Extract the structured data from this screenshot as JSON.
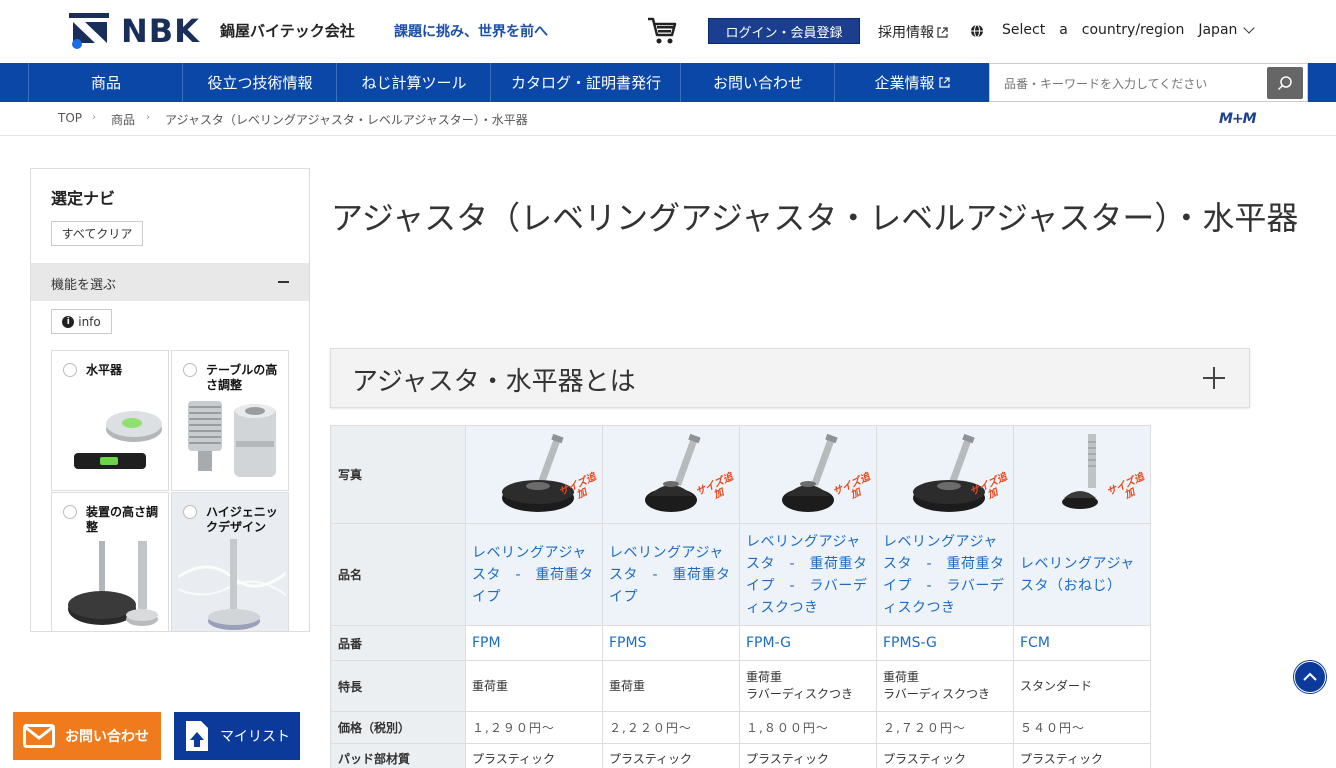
{
  "header": {
    "logo_text": "NBK",
    "company_name": "鍋屋バイテック会社",
    "tagline": "課題に挑み、世界を前へ",
    "login_label": "ログイン・会員登録",
    "recruit_label": "採用情報",
    "region_select": "Select",
    "region_a": "a",
    "region_cr": "country/region",
    "region_value": "Japan"
  },
  "nav": {
    "items": [
      "商品",
      "役立つ技術情報",
      "ねじ計算ツール",
      "カタログ・証明書発行",
      "お問い合わせ",
      "企業情報"
    ],
    "search_placeholder": "品番・キーワードを入力してください"
  },
  "breadcrumb": {
    "items": [
      "TOP",
      "商品",
      "アジャスタ（レベリングアジャスタ・レベルアジャスター）・水平器"
    ],
    "partner_logo": "M+M"
  },
  "sidebar": {
    "title": "選定ナビ",
    "clear_label": "すべてクリア",
    "section_label": "機能を選ぶ",
    "info_label": "info",
    "cards": [
      {
        "label": "水平器"
      },
      {
        "label": "テーブルの高さ調整"
      },
      {
        "label": "装置の高さ調整"
      },
      {
        "label": "ハイジェニックデザイン"
      }
    ]
  },
  "main": {
    "title": "アジャスタ（レベリングアジャスタ・レベルアジャスター）・水平器",
    "accordion_label": "アジャスタ・水平器とは"
  },
  "table": {
    "row_headers": {
      "photo": "写真",
      "name": "品名",
      "code": "品番",
      "feature": "特長",
      "price": "価格（税別）",
      "pad": "パッド部材質"
    },
    "size_tag": "サイズ追加",
    "products": [
      {
        "name": "レベリングアジャスタ　-　重荷重タイプ",
        "code": "FPM",
        "feature": "重荷重",
        "price": "１,２９０円〜",
        "pad": "プラスティック"
      },
      {
        "name": "レベリングアジャスタ　-　重荷重タイプ",
        "code": "FPMS",
        "feature": "重荷重",
        "price": "２,２２０円〜",
        "pad": "プラスティック"
      },
      {
        "name": "レベリングアジャスタ　-　重荷重タイプ　-　ラバーディスクつき",
        "code": "FPM-G",
        "feature": "重荷重\nラバーディスクつき",
        "price": "１,８００円〜",
        "pad": "プラスティック"
      },
      {
        "name": "レベリングアジャスタ　-　重荷重タイプ　-　ラバーディスクつき",
        "code": "FPMS-G",
        "feature": "重荷重\nラバーディスクつき",
        "price": "２,７２０円〜",
        "pad": "プラスティック"
      },
      {
        "name": "レベリングアジャスタ（おねじ）",
        "code": "FCM",
        "feature": "スタンダード",
        "price": "５４０円〜",
        "pad": "プラスティック"
      }
    ]
  },
  "floating": {
    "contact_label": "お問い合わせ",
    "mylist_label": "マイリスト"
  },
  "colors": {
    "brand_blue": "#0a47a6",
    "link_blue": "#1d6cc4",
    "accent_orange": "#f07b1c"
  }
}
